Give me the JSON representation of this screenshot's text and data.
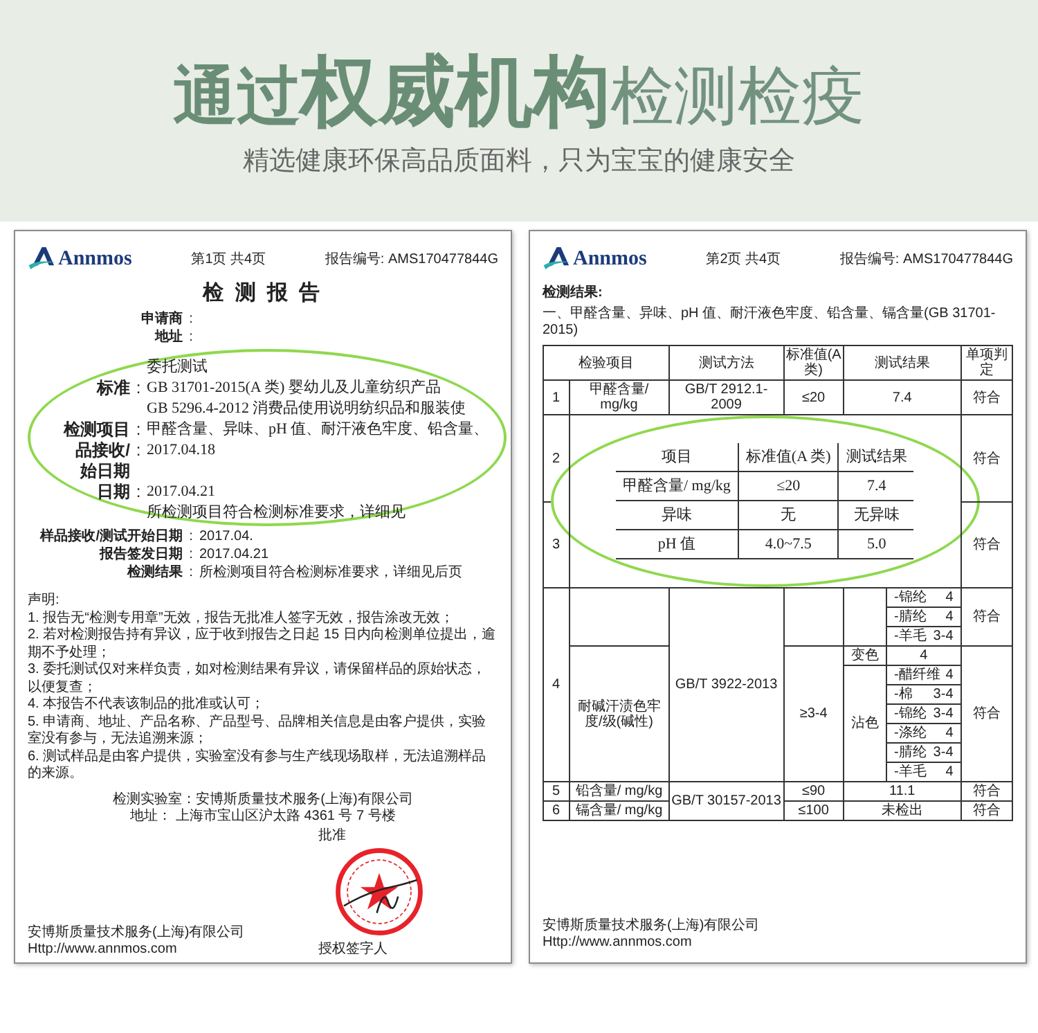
{
  "banner": {
    "title_parts": [
      {
        "text": "通过",
        "kind": "regular"
      },
      {
        "text": "权威机构",
        "kind": "heavy"
      },
      {
        "text": "检测检疫",
        "kind": "light"
      }
    ],
    "subtitle": "精选健康环保高品质面料，只为宝宝的健康安全"
  },
  "report_page_1": {
    "logo": "Annmos",
    "page": "第1页 共4页",
    "report_no": "报告编号: AMS170477844G",
    "title": "检 测 报 告",
    "fields_top": [
      {
        "label": "申请商",
        "separator": ":"
      },
      {
        "label": "地址",
        "separator": ":"
      }
    ],
    "magnified": {
      "lines": [
        {
          "values": [
            "委托测试"
          ]
        },
        {
          "label": "标准",
          "separator": ":",
          "values": [
            "GB 31701-2015(A 类) 婴幼儿及儿童纺织产品",
            "GB 5296.4-2012 消费品使用说明纺织品和服装使"
          ]
        },
        {
          "label": "检测项目",
          "separator": ":",
          "values": [
            "甲醛含量、异味、pH 值、耐汗液色牢度、铅含量、"
          ]
        },
        {
          "label": "品接收/始日期",
          "separator": ":",
          "values": [
            "2017.04.18"
          ]
        },
        {
          "label": "日期",
          "separator": ":",
          "values": [
            "2017.04.21"
          ]
        },
        {
          "values": [
            "所检测项目符合检测标准要求，详细见"
          ]
        }
      ]
    },
    "fields_bottom": [
      {
        "label": "样品接收/测试开始日期",
        "separator": ":",
        "value": "2017.04."
      },
      {
        "label": "报告签发日期",
        "separator": ":",
        "value": "2017.04.21"
      },
      {
        "label": "检测结果",
        "separator": ":",
        "value": "所检测项目符合检测标准要求，详细见后页"
      }
    ],
    "notes_title": "声明:",
    "notes": [
      "1. 报告无“检测专用章”无效，报告无批准人签字无效，报告涂改无效；",
      "2. 若对检测报告持有异议，应于收到报告之日起 15 日内向检测单位提出，逾期不予处理；",
      "3. 委托测试仅对来样负责，如对检测结果有异议，请保留样品的原始状态，以便复查；",
      "4. 本报告不代表该制品的批准或认可；",
      "5. 申请商、地址、产品名称、产品型号、品牌相关信息是由客户提供，实验室没有参与，无法追溯来源；",
      "6. 测试样品是由客户提供，实验室没有参与生产线现场取样，无法追溯样品的来源。"
    ],
    "lab": [
      "检测实验室：安博斯质量技术服务(上海)有限公司",
      "地址： 上海市宝山区沪太路 4361 号 7 号楼"
    ],
    "approver": "批准",
    "signatory": "授权签字人",
    "footer": [
      "安博斯质量技术服务(上海)有限公司",
      "Http://www.annmos.com"
    ]
  },
  "report_page_2": {
    "logo": "Annmos",
    "page": "第2页 共4页",
    "report_no": "报告编号: AMS170477844G",
    "section": "检测结果:",
    "subtitle": "一、甲醛含量、异味、pH 值、耐汗液色牢度、铅含量、镉含量(GB 31701-2015)",
    "columns": [
      "检验项目",
      "测试方法",
      "标准值(A类)",
      "测试结果",
      "单项判定"
    ],
    "row_1": {
      "no": "1",
      "item": "甲醛含量/ mg/kg",
      "method": "GB/T 2912.1-2009",
      "standard": "≤20",
      "result": "7.4",
      "verdict": "符合"
    },
    "covered_rows": [
      {
        "no": "2",
        "verdict": "符合"
      },
      {
        "no": "3",
        "verdict": "符合"
      }
    ],
    "magnified": {
      "columns": [
        "项目",
        "标准值(A 类)",
        "测试结果"
      ],
      "rows": [
        [
          "甲醛含量/ mg/kg",
          "≤20",
          "7.4"
        ],
        [
          "异味",
          "无",
          "无异味"
        ],
        [
          "pH 值",
          "4.0~7.5",
          "5.0"
        ]
      ]
    },
    "row_4": {
      "no": "4",
      "method": "GB/T 3922-2013",
      "upper": {
        "verdict": "符合",
        "results": [
          {
            "fiber": "-锦纶",
            "grade": "4"
          },
          {
            "fiber": "-腈纶",
            "grade": "4"
          },
          {
            "fiber": "-羊毛",
            "grade": "3-4"
          }
        ]
      },
      "lower": {
        "item": "耐碱汗渍色牢度/级(碱性)",
        "standard": "≥3-4",
        "verdict": "符合",
        "change_label": "变色",
        "change_grade": "4",
        "stain_label": "沾色",
        "stains": [
          {
            "fiber": "-醋纤维",
            "grade": "4"
          },
          {
            "fiber": "-棉",
            "grade": "3-4"
          },
          {
            "fiber": "-锦纶",
            "grade": "3-4"
          },
          {
            "fiber": "-涤纶",
            "grade": "4"
          },
          {
            "fiber": "-腈纶",
            "grade": "3-4"
          },
          {
            "fiber": "-羊毛",
            "grade": "4"
          }
        ]
      }
    },
    "rows_5_6": {
      "method": "GB/T 30157-2013",
      "rows": [
        {
          "no": "5",
          "item": "铅含量/ mg/kg",
          "standard": "≤90",
          "result": "11.1",
          "verdict": "符合"
        },
        {
          "no": "6",
          "item": "镉含量/ mg/kg",
          "standard": "≤100",
          "result": "未检出",
          "verdict": "符合"
        }
      ]
    },
    "footer": [
      "安博斯质量技术服务(上海)有限公司",
      "Http://www.annmos.com"
    ]
  }
}
